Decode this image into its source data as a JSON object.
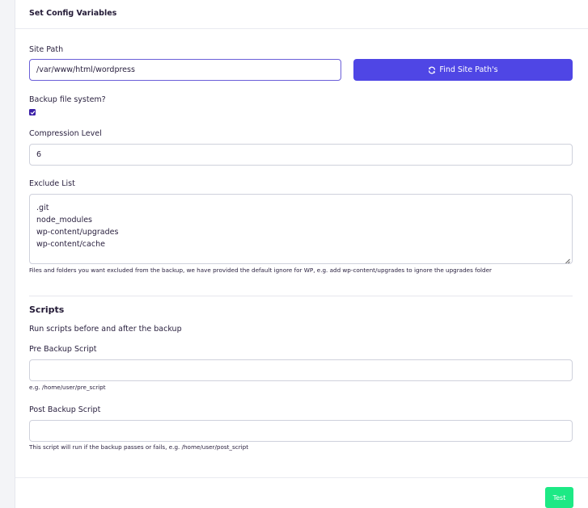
{
  "header": {
    "title": "Set Config Variables"
  },
  "site_path": {
    "label": "Site Path",
    "value": "/var/www/html/wordpress",
    "find_button_label": "Find Site Path's",
    "find_button_icon": "sync-icon",
    "accent_color": "#4f46e5"
  },
  "backup_fs": {
    "label": "Backup file system?",
    "checked": true
  },
  "compression": {
    "label": "Compression Level",
    "value": "6"
  },
  "exclude": {
    "label": "Exclude List",
    "lines": [
      ".git",
      "node_modules",
      "wp-content/upgrades",
      "wp-content/cache"
    ],
    "hint": "Files and folders you want excluded from the backup, we have provided the default ignore for WP, e.g. add wp-content/upgrades to ignore the upgrades folder"
  },
  "scripts": {
    "title": "Scripts",
    "description": "Run scripts before and after the backup",
    "pre": {
      "label": "Pre Backup Script",
      "value": "",
      "hint": "e.g. /home/user/pre_script"
    },
    "post": {
      "label": "Post Backup Script",
      "value": "",
      "hint": "This script will run if the backup passes or fails, e.g. /home/user/post_script"
    }
  },
  "footer": {
    "test_label": "Test",
    "test_color": "#1de985"
  }
}
